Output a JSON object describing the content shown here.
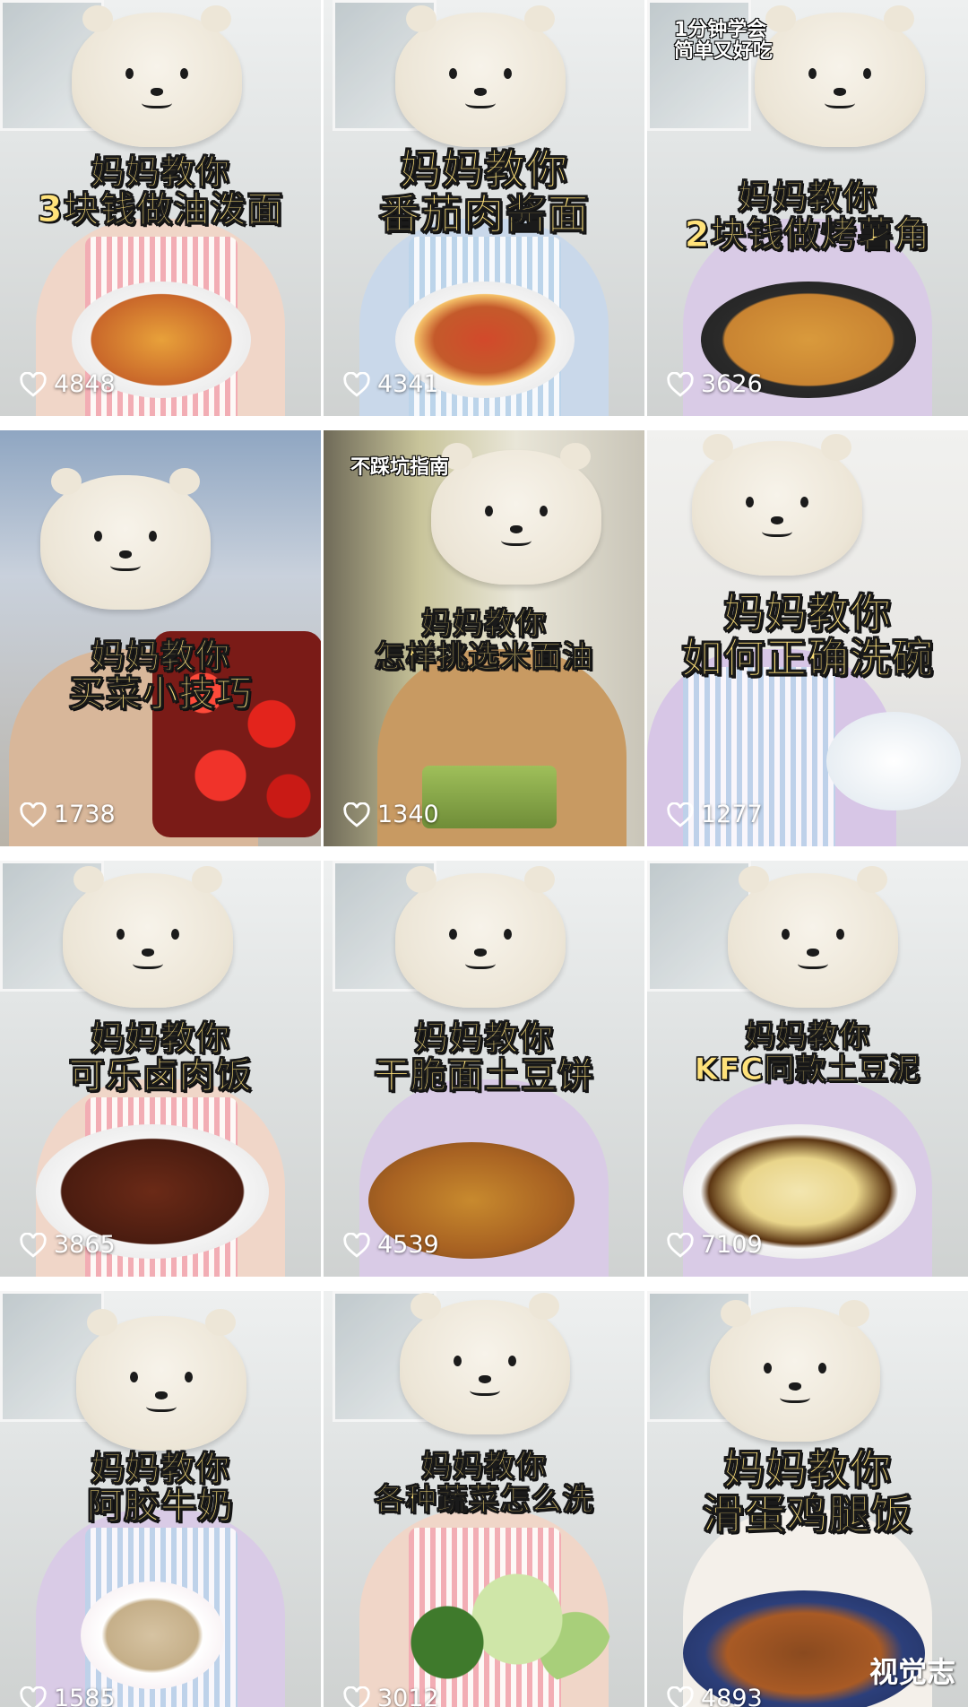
{
  "feed": {
    "videos": [
      {
        "caption_line1": "妈妈教你",
        "caption_line2": "3块钱做油泼面",
        "likes": "4848"
      },
      {
        "caption_line1": "妈妈教你",
        "caption_line2": "番茄肉酱面",
        "likes": "4341"
      },
      {
        "caption_line1": "妈妈教你",
        "caption_line2": "2块钱做烤薯角",
        "likes": "3626",
        "corner_tag_line1": "1分钟学会",
        "corner_tag_line2": "简单又好吃"
      },
      {
        "caption_line1": "妈妈教你",
        "caption_line2": "买菜小技巧",
        "likes": "1738"
      },
      {
        "caption_line1": "妈妈教你",
        "caption_line2": "怎样挑选米面油",
        "likes": "1340",
        "corner_tag_line1": "不踩坑指南"
      },
      {
        "caption_line1": "妈妈教你",
        "caption_line2": "如何正确洗碗",
        "likes": "1277"
      },
      {
        "caption_line1": "妈妈教你",
        "caption_line2": "可乐卤肉饭",
        "likes": "3865"
      },
      {
        "caption_line1": "妈妈教你",
        "caption_line2": "干脆面土豆饼",
        "likes": "4539"
      },
      {
        "caption_line1": "妈妈教你",
        "caption_line2": "KFC同款土豆泥",
        "likes": "7109"
      },
      {
        "caption_line1": "妈妈教你",
        "caption_line2": "阿胶牛奶",
        "likes": "1585"
      },
      {
        "caption_line1": "妈妈教你",
        "caption_line2": "各种蔬菜怎么洗",
        "likes": "3012"
      },
      {
        "caption_line1": "妈妈教你",
        "caption_line2": "滑蛋鸡腿饭",
        "likes": "4893"
      }
    ]
  },
  "watermark": "视觉志",
  "icons": {
    "like": "heart-outline-icon"
  },
  "colors": {
    "caption_text": "#ffe27a",
    "caption_outline": "#1a1a1a",
    "like_text": "#ffffff"
  }
}
